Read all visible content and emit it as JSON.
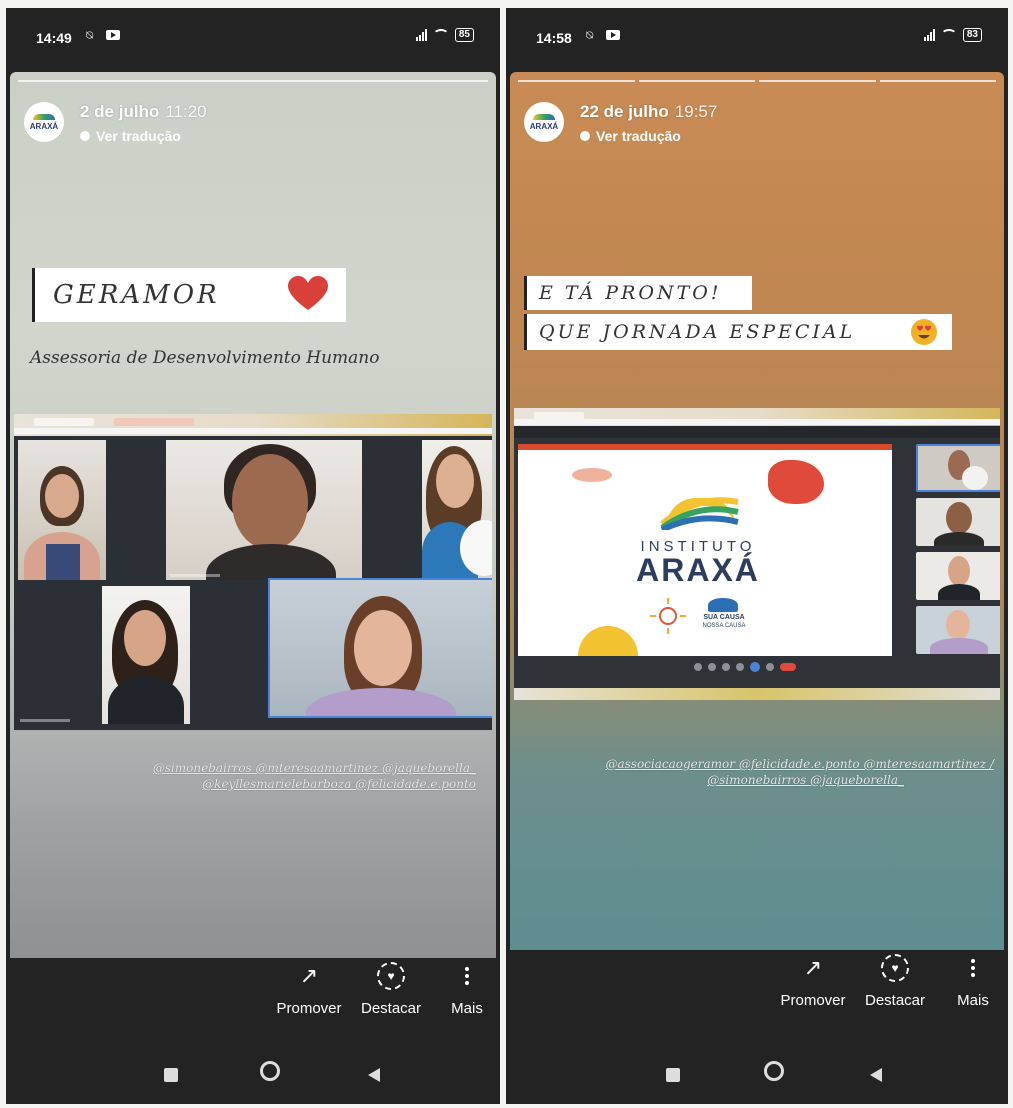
{
  "left": {
    "status": {
      "time": "14:49",
      "battery": "85"
    },
    "story": {
      "account_logo_text": "ARAXÁ",
      "date": "2 de julho",
      "time": "11:20",
      "translate_label": "Ver tradução",
      "headline": "GERAMOR",
      "subtitle": "Assessoria de Desenvolvimento Humano",
      "mentions_line1": "@simonebairros @mteresaamartinez @jaqueborella_",
      "mentions_line2": "@keyllesmarielebarboza @felicidade.e.ponto"
    },
    "actions": {
      "promote": "Promover",
      "highlight": "Destacar",
      "more": "Mais"
    }
  },
  "right": {
    "status": {
      "time": "14:58",
      "battery": "83"
    },
    "story": {
      "account_logo_text": "ARAXÁ",
      "date": "22 de julho",
      "time": "19:57",
      "translate_label": "Ver tradução",
      "line1": "E TÁ PRONTO!",
      "line2": "QUE JORNADA ESPECIAL",
      "slide_title_top": "INSTITUTO",
      "slide_title_main": "ARAXÁ",
      "slide_tagline_1": "SUA CAUSA",
      "slide_tagline_2": "NOSSA CAUSA",
      "mentions_line1": "@associacaogeramor @felicidade.e.ponto @mteresaamartinez /",
      "mentions_line2": "@simonebairros @jaqueborella_"
    },
    "actions": {
      "promote": "Promover",
      "highlight": "Destacar",
      "more": "Mais"
    }
  },
  "colors": {
    "heart": "#d9403a",
    "emoji": "#f2b124",
    "brand_blue": "#2c3e5d"
  }
}
